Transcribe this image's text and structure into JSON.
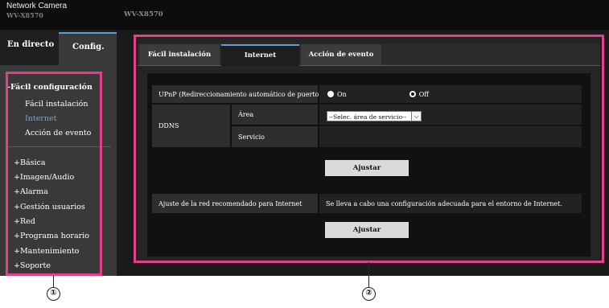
{
  "header": {
    "brand": "Network Camera",
    "model_small": "WV-X8570",
    "model_large": "WV-X8570"
  },
  "left_tabs": {
    "live": "En directo",
    "config": "Config."
  },
  "menu": {
    "group_title": "-Fácil configuración",
    "sub_items": [
      "Fácil instalación",
      "Internet",
      "Acción de evento"
    ],
    "active_sub": "Internet",
    "items": [
      "+Básica",
      "+Imagen/Audio",
      "+Alarma",
      "+Gestión usuarios",
      "+Red",
      "+Programa horario",
      "+Mantenimiento",
      "+Soporte"
    ]
  },
  "tabs": [
    "Fácil instalación",
    "Internet",
    "Acción de evento"
  ],
  "selected_tab": "Internet",
  "form": {
    "upnp_label": "UPnP (Redireccionamiento automático de puerto)",
    "upnp_on": "On",
    "upnp_off": "Off",
    "upnp_value": "Off",
    "ddns_label": "DDNS",
    "area_label": "Área",
    "area_select": "--Selec. área de servicio--",
    "service_label": "Servicio",
    "apply_button": "Ajustar",
    "recommended_label": "Ajuste de la red recomendado para Internet",
    "recommended_desc": "Se lleva a cabo una configuración adecuada para el entorno de Internet.",
    "apply_button_2": "Ajustar"
  },
  "callouts": [
    "①",
    "②"
  ],
  "colors": {
    "accent": "#5f9fd8",
    "highlight": "#e0418a",
    "active_text": "#6ea8dc"
  }
}
